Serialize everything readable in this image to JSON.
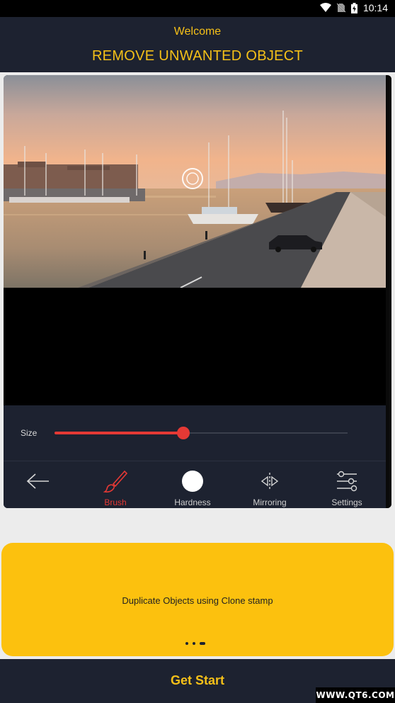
{
  "status_bar": {
    "time": "10:14",
    "icons": [
      "wifi-icon",
      "no-sim-icon",
      "battery-charging-icon"
    ]
  },
  "header": {
    "welcome": "Welcome",
    "title": "REMOVE UNWANTED OBJECT"
  },
  "editor": {
    "size_label": "Size",
    "size_value": 0.44,
    "tools": [
      {
        "icon": "back-arrow-icon",
        "label": ""
      },
      {
        "icon": "brush-icon",
        "label": "Brush",
        "active": true
      },
      {
        "icon": "hardness-circle-icon",
        "label": "Hardness"
      },
      {
        "icon": "mirroring-icon",
        "label": "Mirroring"
      },
      {
        "icon": "settings-sliders-icon",
        "label": "Settings"
      }
    ]
  },
  "slide": {
    "text": "Duplicate Objects using Clone stamp",
    "page_count": 3,
    "current_page": 3
  },
  "footer": {
    "button_label": "Get Start"
  },
  "watermark": "WWW.QT6.COM",
  "colors": {
    "accent": "#f5c018",
    "slide_bg": "#fcc10e",
    "dark_bg": "#1d2230",
    "brush_red": "#e53935"
  }
}
